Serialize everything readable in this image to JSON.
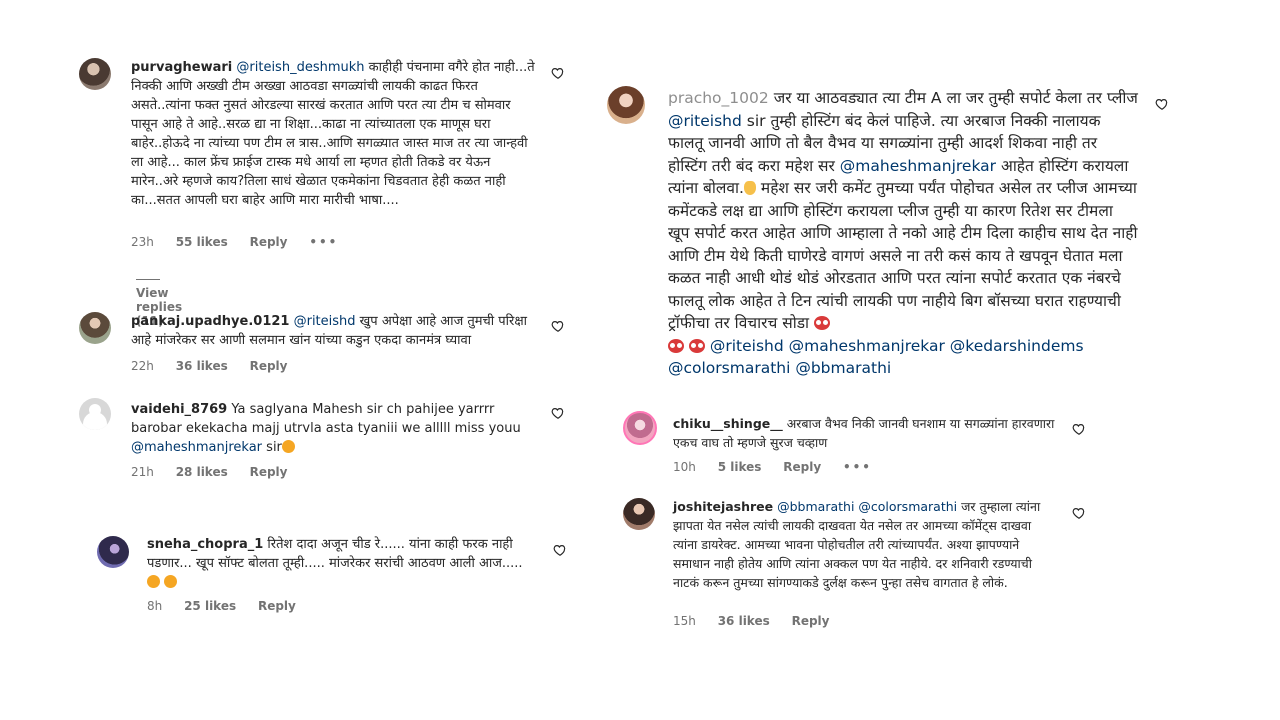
{
  "left": {
    "c1": {
      "username": "purvaghewari",
      "mention": "@riteish_deshmukh",
      "text": "काहीही पंचनामा वगैरे होत नाही...ते निक्की आणि अख्खी टीम अख्खा आठवडा सगळ्यांची लायकी काढत फिरत असते..त्यांना फक्त नुसतं ओरडल्या सारखं करतात आणि परत त्या टीम च सोमवार पासून आहे ते आहे..सरळ द्या ना शिक्षा...काढा ना त्यांच्यातला एक माणूस घरा बाहेर..होऊदे ना त्यांच्या पण टीम ल त्रास..आणि सगळ्यात जास्त माज तर त्या जान्हवी ला आहे... काल फ्रेंच फ्राईज टास्क मधे आर्या ला म्हणत होती तिकडे वर येऊन मारेन..अरे म्हणजे काय?तिला साधं खेळात एकमेकांना चिडवतात हेही कळत नाही का...सतत आपली घरा बाहेर आणि मारा मारीची भाषा....",
      "time": "23h",
      "likes": "55 likes",
      "reply": "Reply",
      "more": "•••",
      "view_replies": "View replies (11)"
    },
    "c2": {
      "username": "pankaj.upadhye.0121",
      "mention": "@riteishd",
      "text": "खुप अपेक्षा आहे आज तुमची परिक्षा आहे मांजरेकर सर आणी सलमान खांन यांच्या कडुन एकदा कानमंत्र घ्यावा",
      "time": "22h",
      "likes": "36 likes",
      "reply": "Reply"
    },
    "c3": {
      "username": "vaidehi_8769",
      "text": "Ya saglyana Mahesh sir ch pahijee yarrrr barobar ekekacha majj utrvla asta tyaniii we alllll miss youu",
      "mention": "@maheshmanjrekar",
      "tail": "sir",
      "time": "21h",
      "likes": "28 likes",
      "reply": "Reply"
    },
    "c4": {
      "username": "sneha_chopra_1",
      "text": "रितेश दादा अजून चीड रे...... यांना काही फरक नाही पडणार... खूप सॉफ्ट बोलता तूम्ही..... मांजरेकर सरांची आठवण आली आज.....",
      "time": "8h",
      "likes": "25 likes",
      "reply": "Reply"
    }
  },
  "right": {
    "c5": {
      "username": "pracho_1002",
      "text1": "जर या आठवड्यात त्या टीम A ला जर तुम्ही सपोर्ट केला तर प्लीज",
      "mention1": "@riteishd",
      "text2": "sir तुम्ही होस्टिंग बंद केलं पाहिजे. त्या अरबाज निक्की नालायक फालतू जानवी आणि तो बैल वैभव या सगळ्यांना तुम्ही आदर्श शिकवा नाही तर होस्टिंग तरी बंद करा महेश सर",
      "mention2": "@maheshmanjrekar",
      "text3": "आहेत होस्टिंग करायला त्यांना बोलवा.",
      "text4": "महेश सर जरी कमेंट तुमच्या पर्यंत पोहोचत असेल तर प्लीज आमच्या कमेंटकडे लक्ष द्या आणि होस्टिंग करायला प्लीज तुम्ही या कारण रितेश सर टीमला खूप सपोर्ट करत आहेत आणि आम्हाला ते नको आहे टीम दिला काहीच साथ देत नाही आणि टीम येथे किती घाणेरडे वागणं असले ना तरी कसं काय ते खपवून घेतात मला कळत नाही आधी थोडं थोडं ओरडतात आणि परत त्यांना सपोर्ट करतात एक नंबरचे फालतू लोक आहेत ते टिन त्यांची लायकी पण नाहीये बिग बॉसच्या घरात राहण्याची ट्रॉफीचा तर विचारच सोडा",
      "tags": "@riteishd @maheshmanjrekar @kedarshindems",
      "tags2": "@colorsmarathi @bbmarathi"
    },
    "c6": {
      "username": "chiku__shinge__",
      "text": "अरबाज वैभव निकी जानवी घनशाम या सगळ्यांना हारवणारा एकच वाघ तो म्हणजे सुरज चव्हाण",
      "time": "10h",
      "likes": "5 likes",
      "reply": "Reply",
      "more": "•••"
    },
    "c7": {
      "username": "joshitejashree",
      "mention": "@bbmarathi @colorsmarathi",
      "text": "जर तुम्हाला त्यांना झापता येत नसेल त्यांची लायकी दाखवता येत नसेल तर आमच्या कॉमेंट्स दाखवा त्यांना डायरेक्ट. आमच्या भावना पोहोचतील तरी त्यांच्यापर्यंत. अश्या झापण्याने समाधान नाही होतेय आणि त्यांना अक्कल पण येत नाहीये. दर शनिवारी रडण्याची नाटकं करून तुमच्या सांगण्याकडे दुर्लक्ष करून पुन्हा तसेच वागतात हे लोकं.",
      "time": "15h",
      "likes": "36 likes",
      "reply": "Reply"
    }
  },
  "icons": {
    "like": "heart-outline-icon"
  },
  "colors": {
    "mention": "#00376b",
    "meta": "#737373",
    "text": "#262626"
  }
}
